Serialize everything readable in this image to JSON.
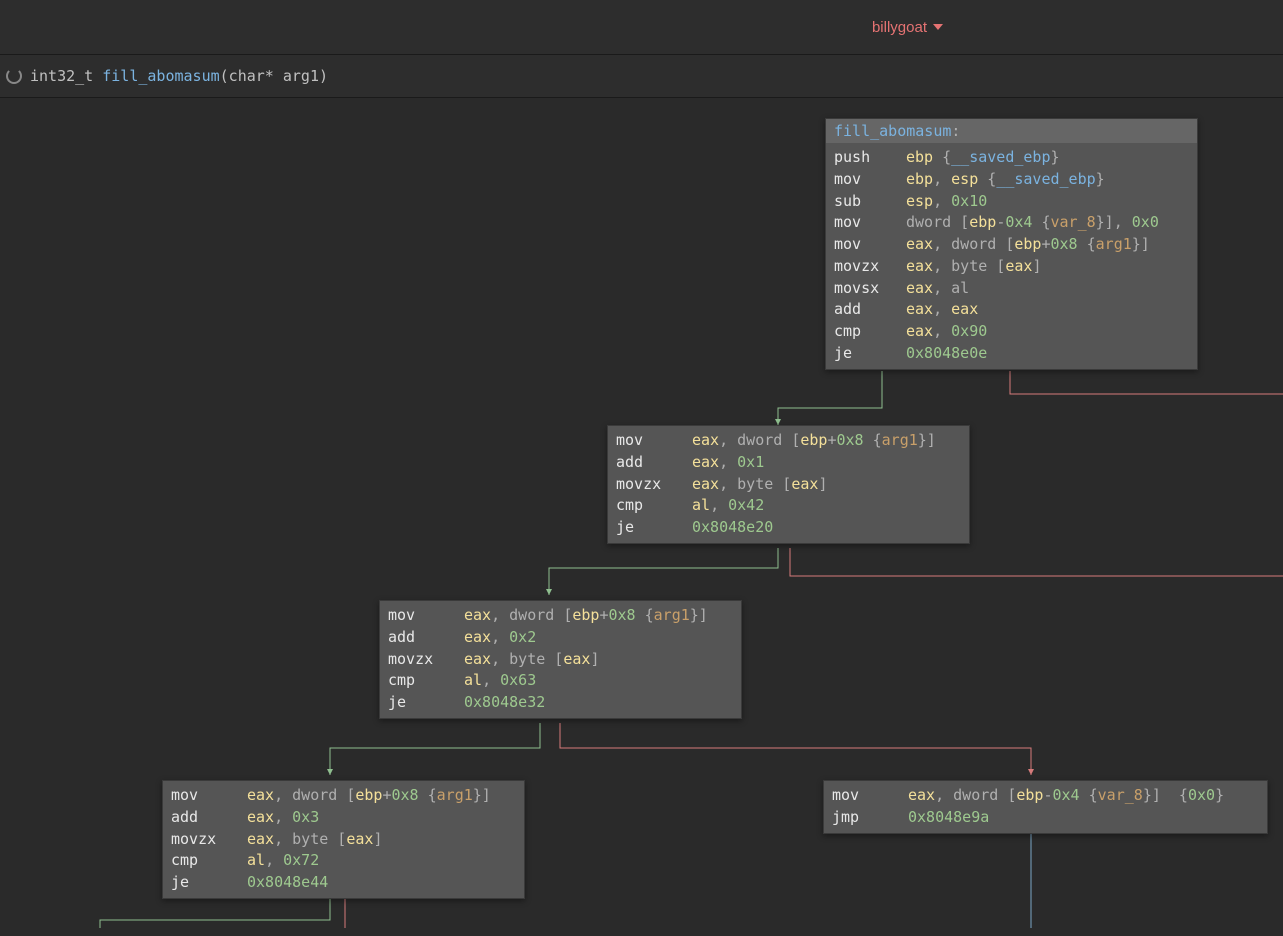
{
  "module_name": "billygoat",
  "signature": {
    "ret_type": "int32_t ",
    "name": "fill_abomasum",
    "params": "(char* arg1)"
  },
  "nodes": {
    "n0": {
      "title_fn": "fill_abomasum",
      "title_colon": ":",
      "lines": [
        [
          [
            "mnem",
            "push"
          ],
          [
            "reg-hl",
            "ebp"
          ],
          [
            "punct",
            " {"
          ],
          [
            "saved",
            "__saved_ebp"
          ],
          [
            "punct",
            "}"
          ]
        ],
        [
          [
            "mnem",
            "mov"
          ],
          [
            "reg-hl",
            "ebp"
          ],
          [
            "punct",
            ", "
          ],
          [
            "reg-hl",
            "esp"
          ],
          [
            "punct",
            " {"
          ],
          [
            "saved",
            "__saved_ebp"
          ],
          [
            "punct",
            "}"
          ]
        ],
        [
          [
            "mnem",
            "sub"
          ],
          [
            "reg-hl",
            "esp"
          ],
          [
            "punct",
            ", "
          ],
          [
            "num",
            "0x10"
          ]
        ],
        [
          [
            "mnem",
            "mov"
          ],
          [
            "punct",
            "dword ["
          ],
          [
            "reg-hl",
            "ebp"
          ],
          [
            "punct",
            "-"
          ],
          [
            "num",
            "0x4"
          ],
          [
            "punct",
            " {"
          ],
          [
            "var",
            "var_8"
          ],
          [
            "punct",
            "}], "
          ],
          [
            "num",
            "0x0"
          ]
        ],
        [
          [
            "mnem",
            "mov"
          ],
          [
            "reg-hl",
            "eax"
          ],
          [
            "punct",
            ", dword ["
          ],
          [
            "reg-hl",
            "ebp"
          ],
          [
            "punct",
            "+"
          ],
          [
            "num",
            "0x8"
          ],
          [
            "punct",
            " {"
          ],
          [
            "arg",
            "arg1"
          ],
          [
            "punct",
            "}]"
          ]
        ],
        [
          [
            "mnem",
            "movzx"
          ],
          [
            "reg-hl",
            "eax"
          ],
          [
            "punct",
            ", byte ["
          ],
          [
            "reg-hl",
            "eax"
          ],
          [
            "punct",
            "]"
          ]
        ],
        [
          [
            "mnem",
            "movsx"
          ],
          [
            "reg-hl",
            "eax"
          ],
          [
            "punct",
            ", "
          ],
          [
            "reg",
            "al"
          ]
        ],
        [
          [
            "mnem",
            "add"
          ],
          [
            "reg-hl",
            "eax"
          ],
          [
            "punct",
            ", "
          ],
          [
            "reg-hl",
            "eax"
          ]
        ],
        [
          [
            "mnem",
            "cmp"
          ],
          [
            "reg-hl",
            "eax"
          ],
          [
            "punct",
            ", "
          ],
          [
            "num",
            "0x90"
          ]
        ],
        [
          [
            "mnem",
            "je"
          ],
          [
            "addr",
            "0x8048e0e"
          ]
        ]
      ]
    },
    "n1": {
      "lines": [
        [
          [
            "mnem-narrow",
            "mov"
          ],
          [
            "reg-hl",
            "eax"
          ],
          [
            "punct",
            ", dword ["
          ],
          [
            "reg-hl",
            "ebp"
          ],
          [
            "punct",
            "+"
          ],
          [
            "num",
            "0x8"
          ],
          [
            "punct",
            " {"
          ],
          [
            "arg",
            "arg1"
          ],
          [
            "punct",
            "}]"
          ]
        ],
        [
          [
            "mnem-narrow",
            "add"
          ],
          [
            "reg-hl",
            "eax"
          ],
          [
            "punct",
            ", "
          ],
          [
            "num",
            "0x1"
          ]
        ],
        [
          [
            "mnem-narrow",
            "movzx"
          ],
          [
            "reg-hl",
            "eax"
          ],
          [
            "punct",
            ", byte ["
          ],
          [
            "reg-hl",
            "eax"
          ],
          [
            "punct",
            "]"
          ]
        ],
        [
          [
            "mnem-narrow",
            "cmp"
          ],
          [
            "reg-hl",
            "al"
          ],
          [
            "punct",
            ", "
          ],
          [
            "num",
            "0x42"
          ]
        ],
        [
          [
            "mnem-narrow",
            "je"
          ],
          [
            "addr",
            "0x8048e20"
          ]
        ]
      ]
    },
    "n2": {
      "lines": [
        [
          [
            "mnem-narrow",
            "mov"
          ],
          [
            "reg-hl",
            "eax"
          ],
          [
            "punct",
            ", dword ["
          ],
          [
            "reg-hl",
            "ebp"
          ],
          [
            "punct",
            "+"
          ],
          [
            "num",
            "0x8"
          ],
          [
            "punct",
            " {"
          ],
          [
            "arg",
            "arg1"
          ],
          [
            "punct",
            "}]"
          ]
        ],
        [
          [
            "mnem-narrow",
            "add"
          ],
          [
            "reg-hl",
            "eax"
          ],
          [
            "punct",
            ", "
          ],
          [
            "num",
            "0x2"
          ]
        ],
        [
          [
            "mnem-narrow",
            "movzx"
          ],
          [
            "reg-hl",
            "eax"
          ],
          [
            "punct",
            ", byte ["
          ],
          [
            "reg-hl",
            "eax"
          ],
          [
            "punct",
            "]"
          ]
        ],
        [
          [
            "mnem-narrow",
            "cmp"
          ],
          [
            "reg-hl",
            "al"
          ],
          [
            "punct",
            ", "
          ],
          [
            "num",
            "0x63"
          ]
        ],
        [
          [
            "mnem-narrow",
            "je"
          ],
          [
            "addr",
            "0x8048e32"
          ]
        ]
      ]
    },
    "n3": {
      "lines": [
        [
          [
            "mnem-narrow",
            "mov"
          ],
          [
            "reg-hl",
            "eax"
          ],
          [
            "punct",
            ", dword ["
          ],
          [
            "reg-hl",
            "ebp"
          ],
          [
            "punct",
            "+"
          ],
          [
            "num",
            "0x8"
          ],
          [
            "punct",
            " {"
          ],
          [
            "arg",
            "arg1"
          ],
          [
            "punct",
            "}]"
          ]
        ],
        [
          [
            "mnem-narrow",
            "add"
          ],
          [
            "reg-hl",
            "eax"
          ],
          [
            "punct",
            ", "
          ],
          [
            "num",
            "0x3"
          ]
        ],
        [
          [
            "mnem-narrow",
            "movzx"
          ],
          [
            "reg-hl",
            "eax"
          ],
          [
            "punct",
            ", byte ["
          ],
          [
            "reg-hl",
            "eax"
          ],
          [
            "punct",
            "]"
          ]
        ],
        [
          [
            "mnem-narrow",
            "cmp"
          ],
          [
            "reg-hl",
            "al"
          ],
          [
            "punct",
            ", "
          ],
          [
            "num",
            "0x72"
          ]
        ],
        [
          [
            "mnem-narrow",
            "je"
          ],
          [
            "addr",
            "0x8048e44"
          ]
        ]
      ]
    },
    "n4": {
      "lines": [
        [
          [
            "mnem-narrow",
            "mov"
          ],
          [
            "reg-hl",
            "eax"
          ],
          [
            "punct",
            ", dword ["
          ],
          [
            "reg-hl",
            "ebp"
          ],
          [
            "punct",
            "-"
          ],
          [
            "num",
            "0x4"
          ],
          [
            "punct",
            " {"
          ],
          [
            "var",
            "var_8"
          ],
          [
            "punct",
            "}]  {"
          ],
          [
            "num",
            "0x0"
          ],
          [
            "punct",
            "}"
          ]
        ],
        [
          [
            "mnem-narrow",
            "jmp"
          ],
          [
            "addr",
            "0x8048e9a"
          ]
        ]
      ]
    }
  }
}
